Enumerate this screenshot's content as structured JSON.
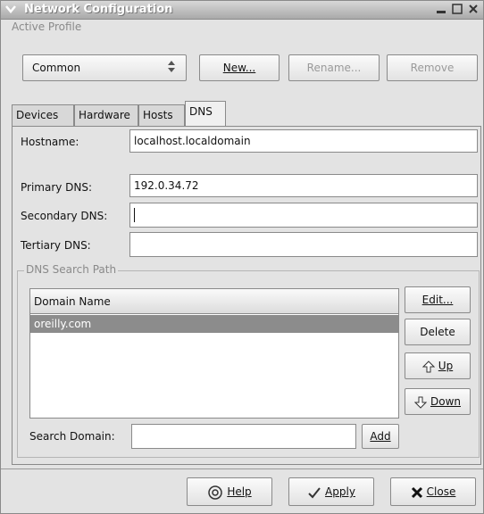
{
  "window": {
    "title": "Network Configuration"
  },
  "profile": {
    "label": "Active Profile",
    "selected": "Common",
    "new_label": "New...",
    "rename_label": "Rename...",
    "remove_label": "Remove"
  },
  "tabs": [
    {
      "label": "Devices"
    },
    {
      "label": "Hardware"
    },
    {
      "label": "Hosts"
    },
    {
      "label": "DNS"
    }
  ],
  "dns": {
    "hostname_label": "Hostname:",
    "hostname_value": "localhost.localdomain",
    "primary_label": "Primary DNS:",
    "primary_value": "192.0.34.72",
    "secondary_label": "Secondary DNS:",
    "secondary_value": "",
    "tertiary_label": "Tertiary DNS:",
    "tertiary_value": ""
  },
  "search_path": {
    "group_label": "DNS Search Path",
    "column_header": "Domain Name",
    "rows": [
      {
        "domain": "oreilly.com"
      }
    ],
    "edit_label": "Edit...",
    "delete_label": "Delete",
    "up_label": "Up",
    "down_label": "Down",
    "search_domain_label": "Search Domain:",
    "search_domain_value": "",
    "add_label": "Add"
  },
  "footer": {
    "help_label": "Help",
    "apply_label": "Apply",
    "close_label": "Close"
  }
}
